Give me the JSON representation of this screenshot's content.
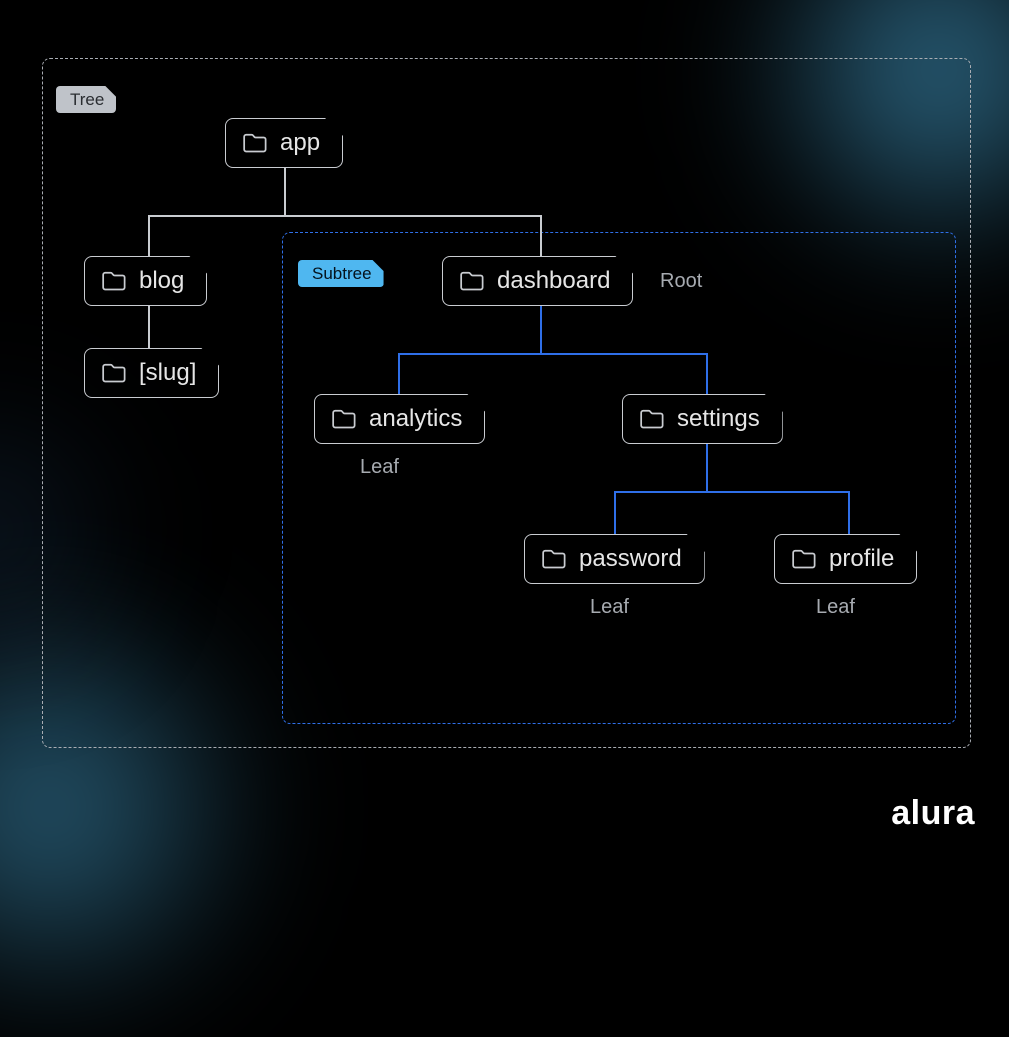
{
  "badges": {
    "tree": "Tree",
    "subtree": "Subtree"
  },
  "nodes": {
    "app": "app",
    "blog": "blog",
    "slug": "[slug]",
    "dashboard": "dashboard",
    "analytics": "analytics",
    "settings": "settings",
    "password": "password",
    "profile": "profile"
  },
  "annotations": {
    "root": "Root",
    "leaf_analytics": "Leaf",
    "leaf_password": "Leaf",
    "leaf_profile": "Leaf"
  },
  "brand": "alura",
  "tree_structure": {
    "app": {
      "children": [
        "blog",
        "dashboard"
      ]
    },
    "blog": {
      "children": [
        "[slug]"
      ]
    },
    "[slug]": {
      "children": []
    },
    "dashboard": {
      "role": "subtree-root",
      "children": [
        "analytics",
        "settings"
      ]
    },
    "analytics": {
      "role": "leaf",
      "children": []
    },
    "settings": {
      "children": [
        "password",
        "profile"
      ]
    },
    "password": {
      "role": "leaf",
      "children": []
    },
    "profile": {
      "role": "leaf",
      "children": []
    }
  },
  "colors": {
    "bg": "#000000",
    "line_default": "#c9ccd1",
    "line_subtree": "#2f6fe8",
    "badge_tree_bg": "#bfc3c9",
    "badge_subtree_bg": "#4fb7f0",
    "accent_glow": "#4eb4e6"
  }
}
